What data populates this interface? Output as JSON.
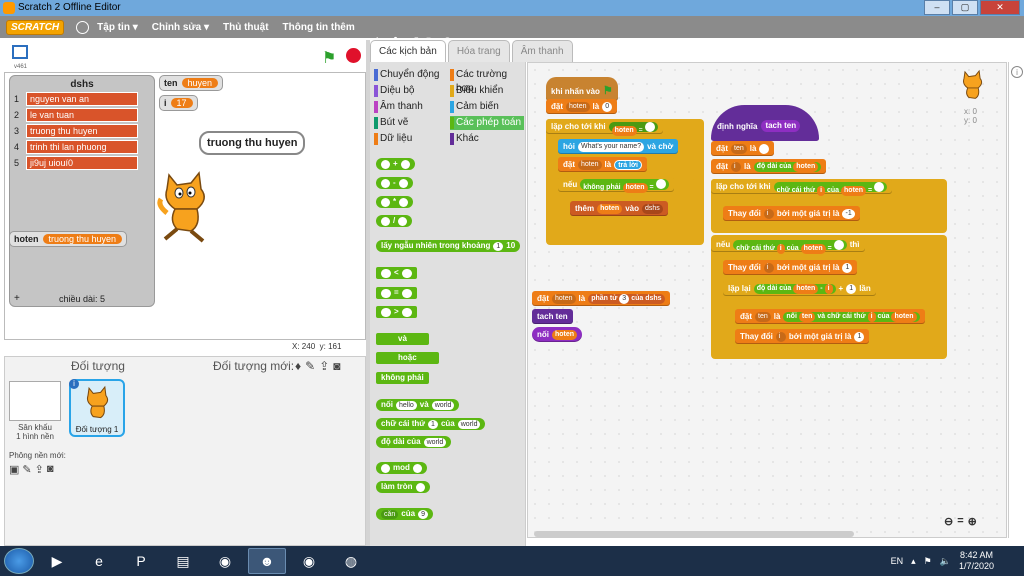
{
  "window": {
    "title": "Scratch 2 Offline Editor"
  },
  "menu": {
    "logo": "SCRATCH",
    "items": [
      "Tập tin ▾",
      "Chỉnh sửa ▾",
      "Thủ thuật",
      "Thông tin thêm"
    ]
  },
  "stage": {
    "version": "v461",
    "list": {
      "name": "dshs",
      "items": [
        "nguyen van an",
        "le van tuan",
        "truong thu huyen",
        "trinh thi lan phuong",
        "ji9uj uiouí0"
      ],
      "length_label": "chiều dài: 5"
    },
    "vars": [
      {
        "name": "ten",
        "value": "huyen"
      },
      {
        "name": "i",
        "value": "17"
      },
      {
        "name": "hoten",
        "value": "truong thu huyen"
      }
    ],
    "speech": "truong thu huyen",
    "coords": {
      "x_label": "X:",
      "x": "240",
      "y_label": "y:",
      "y": "161"
    }
  },
  "sprites": {
    "title": "Đối tượng",
    "new_label": "Đối tượng mới:",
    "stage_label": "Sân khấu",
    "stage_sub": "1 hình nền",
    "new_bg": "Phông nền mới:",
    "sprite_name": "Đối tượng 1"
  },
  "tabs": [
    "Các kịch bản",
    "Hóa trang",
    "Âm thanh"
  ],
  "categories": [
    {
      "label": "Chuyển động",
      "color": "#4a6cd4"
    },
    {
      "label": "Các trường hợp",
      "color": "#ee7d16"
    },
    {
      "label": "Diệu bộ",
      "color": "#8a55d7"
    },
    {
      "label": "Điều khiển",
      "color": "#e1a91a"
    },
    {
      "label": "Âm thanh",
      "color": "#bb42c3"
    },
    {
      "label": "Cảm biến",
      "color": "#2ca5e2"
    },
    {
      "label": "Bút vẽ",
      "color": "#0e9a6c"
    },
    {
      "label": "Các phép toán",
      "color": "#5cb712"
    },
    {
      "label": "Dữ liệu",
      "color": "#ee7d16"
    },
    {
      "label": "Khác",
      "color": "#632d99"
    }
  ],
  "palette": {
    "add": "+",
    "sub": "-",
    "mul": "*",
    "div": "/",
    "random": "lấy ngẫu nhiên trong khoảng",
    "random_a": "1",
    "random_b": "10",
    "lt": "<",
    "eq": "=",
    "gt": ">",
    "and": "và",
    "or": "hoặc",
    "not": "không phải",
    "join": "nối",
    "join_a": "hello",
    "join_b": "world",
    "letter": "chữ cái thứ",
    "letter_n": "1",
    "of": "của",
    "letter_s": "world",
    "length": "độ dài của",
    "length_s": "world",
    "mod": "mod",
    "round": "làm tròn",
    "func": "căn",
    "func_of": "của",
    "func_n": "9"
  },
  "script1": {
    "hat": "khi nhấn vào",
    "set": "đặt",
    "hoten": "hoten",
    "to": "là",
    "zero": "0",
    "until": "lặp cho tới khi",
    "ask": "hỏi",
    "ask_text": "What's your name?",
    "ask_wait": "và chờ",
    "answer": "trả lời",
    "ifnot": "nếu",
    "not": "không phải",
    "eq": "=",
    "add": "thêm",
    "into": "vào",
    "list": "dshs"
  },
  "script2": {
    "set": "đặt",
    "hoten": "hoten",
    "to": "là",
    "item": "phần tử",
    "n": "3",
    "of": "của",
    "list": "dshs",
    "call": "tach ten",
    "join": "nối"
  },
  "script3": {
    "define": "định nghĩa",
    "name": "tach ten",
    "set": "đặt",
    "ten": "ten",
    "to": "là",
    "i": "i",
    "len": "độ dài của",
    "hoten": "hoten",
    "until": "lặp cho tới khi",
    "letter": "chữ cái thứ",
    "of": "của",
    "eq": "=",
    "change": "Thay đổi",
    "by": "bởi một giá trị là",
    "m1": "-1",
    "if": "nếu",
    "then": "thì",
    "one": "1",
    "repeat": "lặp lại",
    "minus": "-",
    "plus": "+",
    "times": "lần",
    "join": "nối",
    "and": "và"
  },
  "sprite_info": {
    "x": "x: 0",
    "y": "y: 0"
  },
  "tray": {
    "lang": "EN",
    "time": "8:42 AM",
    "date": "1/7/2020"
  }
}
